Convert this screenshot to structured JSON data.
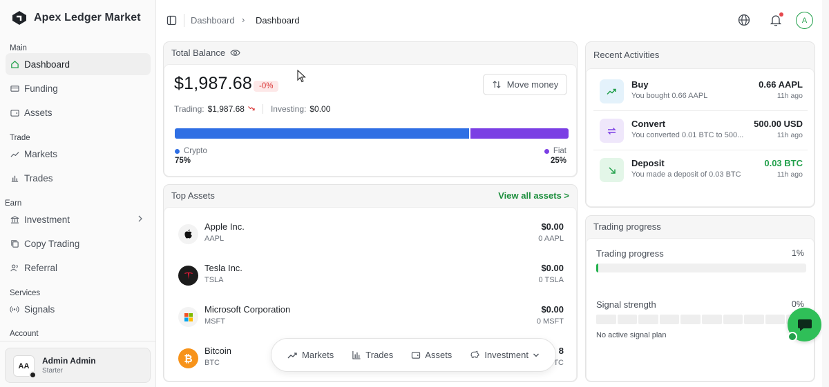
{
  "brand": {
    "name": "Apex Ledger Market"
  },
  "sidebar": {
    "sections": {
      "main": "Main",
      "trade": "Trade",
      "earn": "Earn",
      "services": "Services",
      "account": "Account"
    },
    "items": [
      {
        "label": "Dashboard",
        "icon": "home-icon",
        "active": true
      },
      {
        "label": "Funding",
        "icon": "card-icon"
      },
      {
        "label": "Assets",
        "icon": "wallet-icon"
      },
      {
        "label": "Markets",
        "icon": "trend-icon"
      },
      {
        "label": "Trades",
        "icon": "chart-icon"
      },
      {
        "label": "Investment",
        "icon": "bank-icon"
      },
      {
        "label": "Copy Trading",
        "icon": "copy-icon"
      },
      {
        "label": "Referral",
        "icon": "users-icon"
      },
      {
        "label": "Signals",
        "icon": "signal-icon"
      }
    ],
    "user": {
      "initials": "AA",
      "name": "Admin Admin",
      "plan": "Starter"
    }
  },
  "header": {
    "breadcrumb": [
      "Dashboard",
      "Dashboard"
    ],
    "avatar": "A"
  },
  "balance_card": {
    "title": "Total Balance",
    "amount": "$1,987.68",
    "change": "-0%",
    "move_money": "Move money",
    "trading_label": "Trading:",
    "trading_value": "$1,987.68",
    "investing_label": "Investing:",
    "investing_value": "$0.00",
    "allocation": [
      {
        "name": "Crypto",
        "percent_label": "75%",
        "value": 75,
        "color": "#2f6fe4"
      },
      {
        "name": "Fiat",
        "percent_label": "25%",
        "value": 25,
        "color": "#7b3fe4"
      }
    ]
  },
  "top_assets": {
    "title": "Top Assets",
    "view_all": "View all assets >",
    "rows": [
      {
        "name": "Apple Inc.",
        "symbol": "AAPL",
        "value": "$0.00",
        "qty": "0 AAPL"
      },
      {
        "name": "Tesla Inc.",
        "symbol": "TSLA",
        "value": "$0.00",
        "qty": "0 TSLA"
      },
      {
        "name": "Microsoft Corporation",
        "symbol": "MSFT",
        "value": "$0.00",
        "qty": "0 MSFT"
      },
      {
        "name": "Bitcoin",
        "symbol": "BTC",
        "value": "8",
        "qty": "TC"
      }
    ]
  },
  "floating_nav": {
    "items": [
      "Markets",
      "Trades",
      "Assets",
      "Investment"
    ]
  },
  "recent_activities": {
    "title": "Recent Activities",
    "rows": [
      {
        "title": "Buy",
        "desc": "You bought 0.66 AAPL",
        "amount": "0.66 AAPL",
        "time": "11h ago",
        "color": "#1f2328"
      },
      {
        "title": "Convert",
        "desc": "You converted 0.01 BTC to 500...",
        "amount": "500.00 USD",
        "time": "11h ago",
        "color": "#1f2328"
      },
      {
        "title": "Deposit",
        "desc": "You made a deposit of 0.03 BTC",
        "amount": "0.03 BTC",
        "time": "11h ago",
        "color": "#22a04b"
      }
    ]
  },
  "trading_progress": {
    "title": "Trading progress",
    "progress_label": "Trading progress",
    "progress_value": "1%",
    "progress": 0.01,
    "signal_label": "Signal strength",
    "signal_value": "0%",
    "signal_note": "No active signal plan"
  }
}
